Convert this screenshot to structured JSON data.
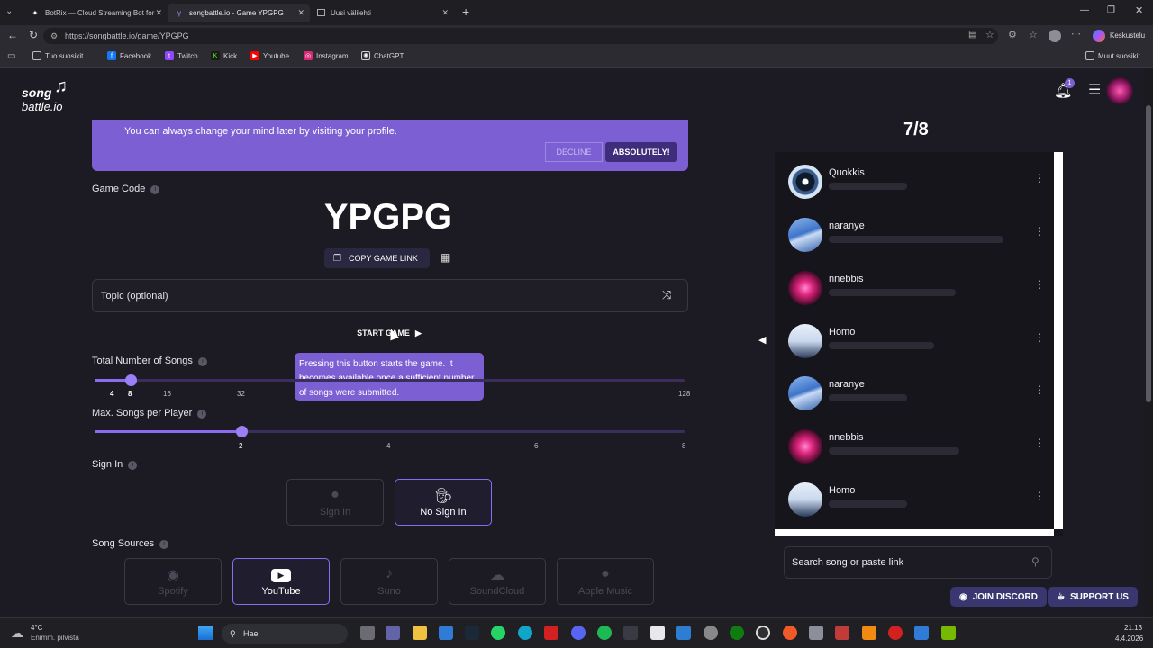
{
  "browser": {
    "tabs": [
      {
        "title": "BotRix — Cloud Streaming Bot for"
      },
      {
        "title": "songbattle.io - Game YPGPG"
      },
      {
        "title": "Uusi välilehti"
      }
    ],
    "url": "https://songbattle.io/game/YPGPG",
    "profile_label": "Keskustelu",
    "bookmarks": [
      "Tuo suosikit",
      "Facebook",
      "Twitch",
      "Kick",
      "Youtube",
      "Instagram",
      "ChatGPT"
    ],
    "other_bookmarks": "Muut suosikit"
  },
  "site": {
    "logo_top": "song",
    "logo_bottom": "battle.io",
    "notification_count": "1"
  },
  "banner": {
    "text": "You can always change your mind later by visiting your profile.",
    "decline": "DECLINE",
    "accept": "ABSOLUTELY!"
  },
  "game": {
    "code_label": "Game Code",
    "code": "YPGPG",
    "copy_link": "COPY GAME LINK",
    "topic_placeholder": "Topic (optional)",
    "start": "START GAME",
    "tooltip": "Pressing this button starts the game. It becomes available once a sufficient number of songs were submitted."
  },
  "settings": {
    "total_songs_label": "Total Number of Songs",
    "total_ticks": [
      "4",
      "8",
      "16",
      "32",
      "128"
    ],
    "total_value": 8,
    "max_songs_label": "Max. Songs per Player",
    "max_ticks": [
      "2",
      "4",
      "6",
      "8"
    ],
    "max_value": 2,
    "sign_in_label": "Sign In",
    "sign_in_options": [
      "Sign In",
      "No Sign In"
    ],
    "sources_label": "Song Sources",
    "sources": [
      "Spotify",
      "YouTube",
      "Suno",
      "SoundCloud",
      "Apple Music"
    ],
    "selected_source": "YouTube"
  },
  "players": {
    "count": "7/8",
    "list": [
      {
        "name": "Quokkis"
      },
      {
        "name": "naranye"
      },
      {
        "name": "nnebbis"
      },
      {
        "name": "Homo"
      },
      {
        "name": "naranye"
      },
      {
        "name": "nnebbis"
      },
      {
        "name": "Homo"
      }
    ]
  },
  "search": {
    "placeholder": "Search song or paste link"
  },
  "footer": {
    "discord": "JOIN DISCORD",
    "support": "SUPPORT US"
  },
  "taskbar": {
    "weather_temp": "4°C",
    "weather_desc": "Enimm. pilvistä",
    "search": "Hae",
    "time": "21.13",
    "date": "4.4.2026"
  },
  "colors": {
    "accent": "#8a6cf0",
    "banner": "#7c5fd2",
    "background": "#1c1b23"
  }
}
